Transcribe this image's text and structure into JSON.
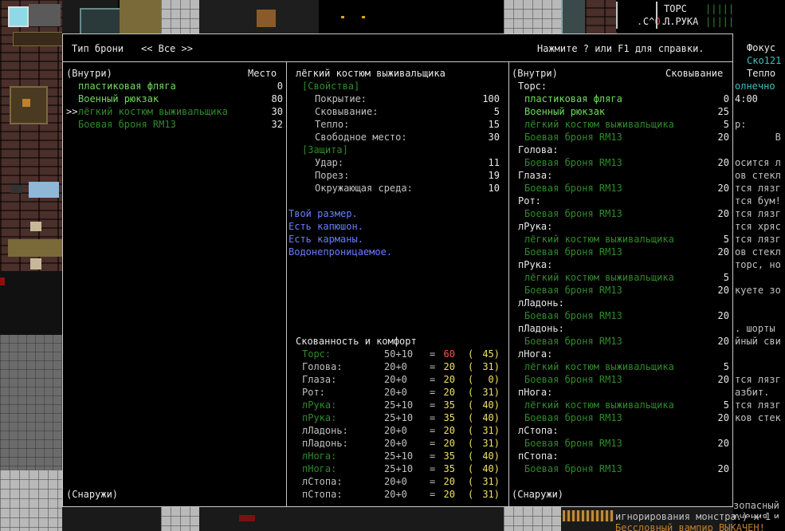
{
  "header": {
    "armor_type_label": "Тип брони",
    "filter": "<< Все >>",
    "help_hint": "Нажмите ? или F1 для справки."
  },
  "left_panel": {
    "inside_label": "(Внутри)",
    "place_label": "Место",
    "outside_label": "(Снаружи)",
    "items": [
      {
        "name": "пластиковая фляга",
        "value": "0",
        "selected": false,
        "color": "#6fdc5a"
      },
      {
        "name": "Военный рюкзак",
        "value": "80",
        "selected": false,
        "color": "#6fdc5a"
      },
      {
        "name": "лёгкий костюм выживальщика",
        "value": "30",
        "selected": true,
        "color": "#2f8a2a"
      },
      {
        "name": "Боевая броня RM13",
        "value": "32",
        "selected": false,
        "color": "#2f8a2a"
      }
    ],
    "cursor": ">>"
  },
  "middle_panel": {
    "item_name": "лёгкий костюм выживальщика",
    "properties_label": "[Свойства]",
    "properties": [
      {
        "label": "Покрытие:",
        "value": "100"
      },
      {
        "label": "Сковывание:",
        "value": "5"
      },
      {
        "label": "Тепло:",
        "value": "15"
      },
      {
        "label": "Свободное место:",
        "value": "30"
      }
    ],
    "protection_label": "[Защита]",
    "protection": [
      {
        "label": "Удар:",
        "value": "11"
      },
      {
        "label": "Порез:",
        "value": "19"
      },
      {
        "label": "Окружающая среда:",
        "value": "10"
      }
    ],
    "notes": [
      "Твой размер.",
      "Есть капюшон.",
      "Есть карманы.",
      "Водонепроницаемое."
    ],
    "comfort_title": "Скованность и комфорт",
    "comfort": [
      {
        "part": "Торс:",
        "base": "50+10",
        "eq": "=",
        "total": "60",
        "open": "(",
        "warmth": "45)",
        "highlight": true,
        "total_red": true
      },
      {
        "part": "Голова:",
        "base": "20+0",
        "eq": "=",
        "total": "20",
        "open": "(",
        "warmth": "31)",
        "highlight": false,
        "total_red": false
      },
      {
        "part": "Глаза:",
        "base": "20+0",
        "eq": "=",
        "total": "20",
        "open": "(",
        "warmth": "0)",
        "highlight": false,
        "total_red": false
      },
      {
        "part": "Рот:",
        "base": "20+0",
        "eq": "=",
        "total": "20",
        "open": "(",
        "warmth": "31)",
        "highlight": false,
        "total_red": false
      },
      {
        "part": "лРука:",
        "base": "25+10",
        "eq": "=",
        "total": "35",
        "open": "(",
        "warmth": "40)",
        "highlight": true,
        "total_red": false
      },
      {
        "part": "пРука:",
        "base": "25+10",
        "eq": "=",
        "total": "35",
        "open": "(",
        "warmth": "40)",
        "highlight": true,
        "total_red": false
      },
      {
        "part": "лЛадонь:",
        "base": "20+0",
        "eq": "=",
        "total": "20",
        "open": "(",
        "warmth": "31)",
        "highlight": false,
        "total_red": false
      },
      {
        "part": "пЛадонь:",
        "base": "20+0",
        "eq": "=",
        "total": "20",
        "open": "(",
        "warmth": "31)",
        "highlight": false,
        "total_red": false
      },
      {
        "part": "лНога:",
        "base": "25+10",
        "eq": "=",
        "total": "35",
        "open": "(",
        "warmth": "40)",
        "highlight": true,
        "total_red": false
      },
      {
        "part": "пНога:",
        "base": "25+10",
        "eq": "=",
        "total": "35",
        "open": "(",
        "warmth": "40)",
        "highlight": true,
        "total_red": false
      },
      {
        "part": "лСтопа:",
        "base": "20+0",
        "eq": "=",
        "total": "20",
        "open": "(",
        "warmth": "31)",
        "highlight": false,
        "total_red": false
      },
      {
        "part": "пСтопа:",
        "base": "20+0",
        "eq": "=",
        "total": "20",
        "open": "(",
        "warmth": "31)",
        "highlight": false,
        "total_red": false
      }
    ]
  },
  "right_panel": {
    "inside_label": "(Внутри)",
    "encumbrance_label": "Сковывание",
    "outside_label": "(Снаружи)",
    "rows": [
      {
        "kind": "part",
        "text": "Торс:"
      },
      {
        "kind": "item",
        "text": "пластиковая фляга",
        "value": "0",
        "tone": "light"
      },
      {
        "kind": "item",
        "text": "Военный рюкзак",
        "value": "25",
        "tone": "light"
      },
      {
        "kind": "item",
        "text": "лёгкий костюм выживальщика",
        "value": "5",
        "tone": "dark"
      },
      {
        "kind": "item",
        "text": "Боевая броня RM13",
        "value": "20",
        "tone": "dark"
      },
      {
        "kind": "part",
        "text": "Голова:"
      },
      {
        "kind": "item",
        "text": "Боевая броня RM13",
        "value": "20",
        "tone": "dark"
      },
      {
        "kind": "part",
        "text": "Глаза:"
      },
      {
        "kind": "item",
        "text": "Боевая броня RM13",
        "value": "20",
        "tone": "dark"
      },
      {
        "kind": "part",
        "text": "Рот:"
      },
      {
        "kind": "item",
        "text": "Боевая броня RM13",
        "value": "20",
        "tone": "dark"
      },
      {
        "kind": "part",
        "text": "лРука:"
      },
      {
        "kind": "item",
        "text": "лёгкий костюм выживальщика",
        "value": "5",
        "tone": "dark"
      },
      {
        "kind": "item",
        "text": "Боевая броня RM13",
        "value": "20",
        "tone": "dark"
      },
      {
        "kind": "part",
        "text": "пРука:"
      },
      {
        "kind": "item",
        "text": "лёгкий костюм выживальщика",
        "value": "5",
        "tone": "dark"
      },
      {
        "kind": "item",
        "text": "Боевая броня RM13",
        "value": "20",
        "tone": "dark"
      },
      {
        "kind": "part",
        "text": "лЛадонь:"
      },
      {
        "kind": "item",
        "text": "Боевая броня RM13",
        "value": "20",
        "tone": "dark"
      },
      {
        "kind": "part",
        "text": "пЛадонь:"
      },
      {
        "kind": "item",
        "text": "Боевая броня RM13",
        "value": "20",
        "tone": "dark"
      },
      {
        "kind": "part",
        "text": "лНога:"
      },
      {
        "kind": "item",
        "text": "лёгкий костюм выживальщика",
        "value": "5",
        "tone": "dark"
      },
      {
        "kind": "item",
        "text": "Боевая броня RM13",
        "value": "20",
        "tone": "dark"
      },
      {
        "kind": "part",
        "text": "пНога:"
      },
      {
        "kind": "item",
        "text": "лёгкий костюм выживальщика",
        "value": "5",
        "tone": "dark"
      },
      {
        "kind": "item",
        "text": "Боевая броня RM13",
        "value": "20",
        "tone": "dark"
      },
      {
        "kind": "part",
        "text": "лСтопа:"
      },
      {
        "kind": "item",
        "text": "Боевая броня RM13",
        "value": "20",
        "tone": "dark"
      },
      {
        "kind": "part",
        "text": "пСтопа:"
      },
      {
        "kind": "item",
        "text": "Боевая броня RM13",
        "value": "20",
        "tone": "dark"
      }
    ]
  },
  "hud": {
    "status_left": "С^",
    "status_o": "О",
    "status_dots": "..",
    "status_dots2": "..",
    "torso": "ТОРС",
    "torso_bars": "|||||",
    "larm": "Л.РУКА",
    "larm_bars": "|||||"
  },
  "sidebar": {
    "lines": [
      {
        "text": "Фокус",
        "color": "#e8e8e8"
      },
      {
        "text": "Ско121",
        "color": "#40c0c0"
      },
      {
        "text": "Тепло",
        "color": "#e8e8e8"
      },
      {
        "text": "олнечно",
        "color": "#40c0c0"
      },
      {
        "text": "4:00",
        "color": "#e8e8e8"
      },
      {
        "text": "",
        "color": "#e8e8e8"
      },
      {
        "text": "р:",
        "color": "#c0c0c0"
      },
      {
        "text": "       В",
        "color": "#c0c0c0"
      },
      {
        "text": "",
        "color": "#c0c0c0"
      },
      {
        "text": "осится л",
        "color": "#c0c0c0"
      },
      {
        "text": "ов стекл",
        "color": "#c0c0c0"
      },
      {
        "text": "тся лязг",
        "color": "#c0c0c0"
      },
      {
        "text": "тся бум!",
        "color": "#c0c0c0"
      },
      {
        "text": "тся лязг",
        "color": "#c0c0c0"
      },
      {
        "text": "тся хряс",
        "color": "#c0c0c0"
      },
      {
        "text": "тся лязг",
        "color": "#c0c0c0"
      },
      {
        "text": "ов стекл",
        "color": "#c0c0c0"
      },
      {
        "text": "торс, но",
        "color": "#c0c0c0"
      },
      {
        "text": "",
        "color": "#c0c0c0"
      },
      {
        "text": "куете зо",
        "color": "#c0c0c0"
      },
      {
        "text": "",
        "color": "#c0c0c0"
      },
      {
        "text": "",
        "color": "#c0c0c0"
      },
      {
        "text": ". шорты",
        "color": "#c0c0c0"
      },
      {
        "text": "йный сви",
        "color": "#c0c0c0"
      },
      {
        "text": "",
        "color": "#c0c0c0"
      },
      {
        "text": "",
        "color": "#c0c0c0"
      },
      {
        "text": "тся лязг",
        "color": "#c0c0c0"
      },
      {
        "text": "азбит.",
        "color": "#c0c0c0"
      },
      {
        "text": "тся лязг",
        "color": "#c0c0c0"
      },
      {
        "text": "ков стек",
        "color": "#c0c0c0"
      }
    ],
    "bottom_lines": [
      "зопасный",
      "ючения и"
    ],
    "footer_line1": "игнорирования монстра.) x 1",
    "footer_line2": "Бессловный вампир ВЫКАЧЕН!"
  },
  "colors": {
    "light_green": "#6fdc5a",
    "dark_green": "#2f8a2a",
    "blue_note": "#6a7cff",
    "yellow_total": "#f0e060",
    "red_total": "#ff5050",
    "border": "#c8c8c8"
  }
}
